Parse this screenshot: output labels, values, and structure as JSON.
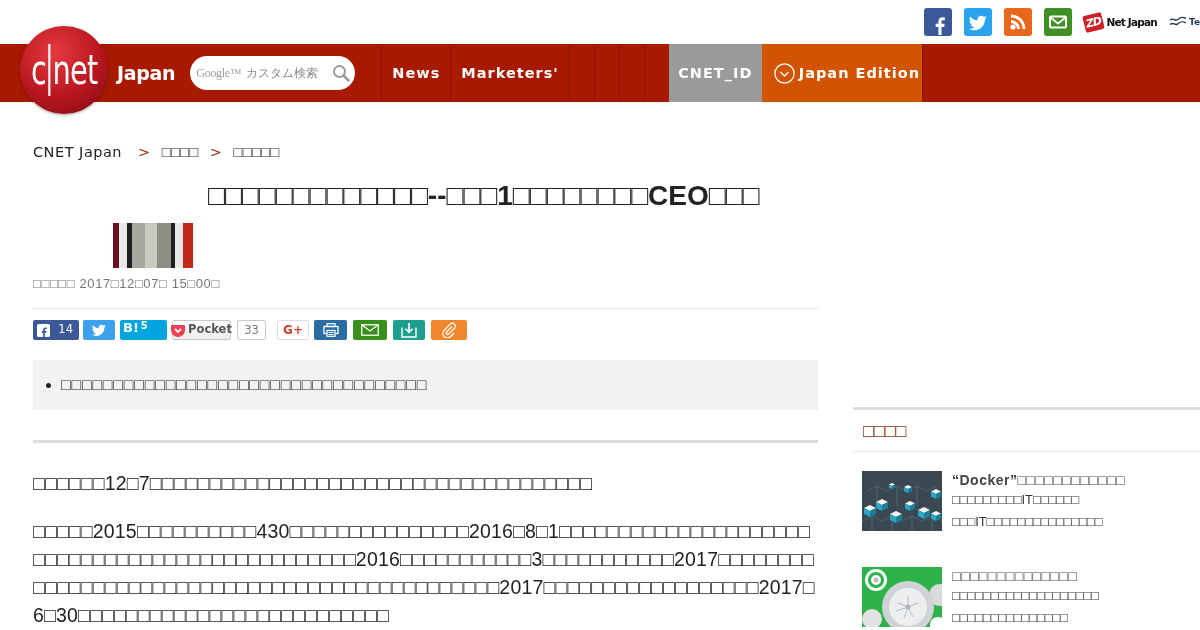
{
  "top_bar": {
    "social_links": [
      {
        "kind": "facebook"
      },
      {
        "kind": "twitter"
      },
      {
        "kind": "rss"
      },
      {
        "kind": "mail"
      }
    ],
    "partner_logos": [
      {
        "kind": "zdnet",
        "mark": "ZD",
        "name": "Net Japan"
      },
      {
        "kind": "wave",
        "name": "Te"
      }
    ]
  },
  "header": {
    "logo": {
      "left": "c",
      "right": "net",
      "suffix": "Japan"
    },
    "search": {
      "brand": "Google™",
      "placeholder": "カスタム検索"
    },
    "nav": [
      {
        "kind": "link",
        "label": "News"
      },
      {
        "kind": "link",
        "label": "Marketers'"
      },
      {
        "kind": "blank"
      },
      {
        "kind": "blank"
      },
      {
        "kind": "blank"
      },
      {
        "kind": "blank"
      },
      {
        "kind": "account",
        "label": "CNET_ID"
      },
      {
        "kind": "edition",
        "label": "Japan Edition"
      }
    ]
  },
  "breadcrumb": [
    {
      "kind": "link",
      "label": "CNET Japan"
    },
    {
      "kind": "separator",
      "label": ">"
    },
    {
      "kind": "link",
      "label": "□□□□"
    },
    {
      "kind": "separator",
      "label": ">"
    },
    {
      "kind": "link",
      "label": "□□□□□"
    }
  ],
  "article": {
    "title": "□□□□□□□□□□□□□--□□□1□□□□□□□□CEO□□□",
    "date": "□□□□□ 2017□12□07□ 15□00□",
    "share_buttons": [
      {
        "kind": "facebook",
        "count": "14"
      },
      {
        "kind": "twitter"
      },
      {
        "kind": "hatena",
        "label": "B!",
        "count": "5"
      },
      {
        "kind": "pocket",
        "label": "Pocket",
        "count": "33"
      },
      {
        "kind": "gplus",
        "label": "G+"
      },
      {
        "kind": "print"
      },
      {
        "kind": "mail"
      },
      {
        "kind": "save"
      },
      {
        "kind": "clip"
      }
    ],
    "summary": [
      "□□□□□□□□□□□□□□□□□□□□□□□□□□□□□□□□□□□"
    ],
    "paragraphs": [
      "□□□□□□12□7□□□□□□□□□□□□□□□□□□□□□□□□□□□□□□□□□□□□□",
      "□□□□□2015□□□□□□□□□□430□□□□□□□□□□□□□□□2016□8□1□□□□□□□□□□□□□□□□□□□□□□□□□□□□□□□□□□□□□□□□□□□□□□□□2016□□□□□□□□□□□3□□□□□□□□□□□2017□□□□□□□□□□□□□□□□□□□□□□□□□□□□□□□□□□□□□□□□□□□□□□□2017□□□□□□□□□□□□□□□□□□2017□6□30□□□□□□□□□□□□□□□□□□□□□□□□□□"
    ]
  },
  "sidebar": {
    "heading": "□□□□",
    "items": [
      {
        "kind": "cubes",
        "title": "“Docker”□□□□□□□□□□□□",
        "lines": [
          "□□□□□□□□□IT□□□□□□",
          "□□□IT□□□□□□□□□□□□□□□"
        ]
      },
      {
        "kind": "circles",
        "title": "□□□□□□□□□□□□□□",
        "lines": [
          "□□□□□□□□□□□□□□□□□□□",
          "□□□□□□□□□□□□□□□"
        ]
      }
    ]
  }
}
